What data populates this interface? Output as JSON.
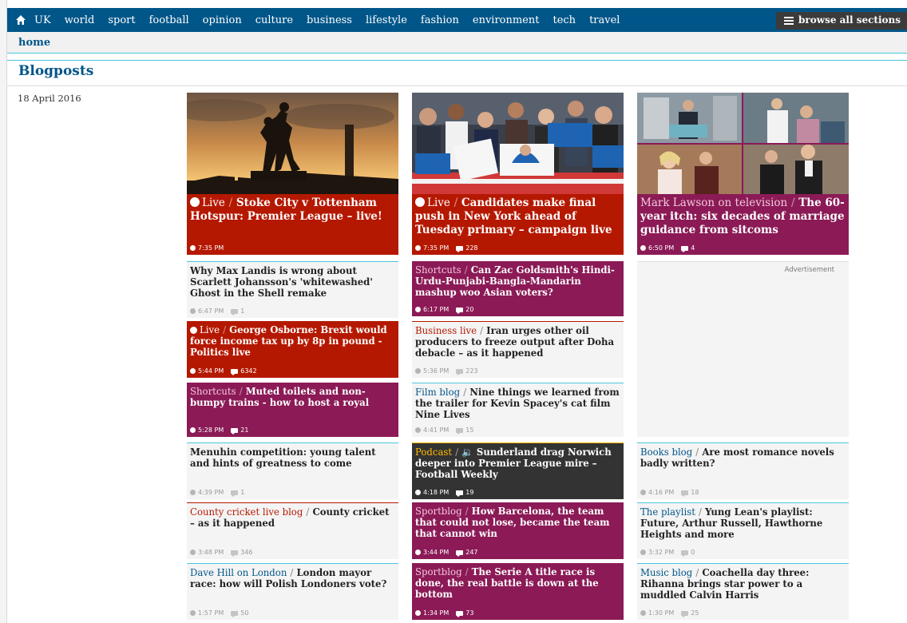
{
  "nav": {
    "items": [
      "UK",
      "world",
      "sport",
      "football",
      "opinion",
      "culture",
      "business",
      "lifestyle",
      "fashion",
      "environment",
      "tech",
      "travel"
    ],
    "browse_label": "browse all sections"
  },
  "breadcrumb": {
    "home": "home"
  },
  "page": {
    "title": "Blogposts",
    "date": "18 April 2016"
  },
  "colors": {
    "nav": "#005689",
    "live_red": "#b51800",
    "plum": "#8b1a56",
    "dark": "#333333",
    "accent": "#4bc6df",
    "podcast_kicker": "#ffbb00"
  },
  "cards": [
    {
      "live": true,
      "kicker": "Live",
      "headline": "Stoke City v Tottenham Hotspur: Premier League – live!",
      "time": "7:35 PM",
      "comments": ""
    },
    {
      "live": true,
      "kicker": "Live",
      "headline": "Candidates make final push in New York ahead of Tuesday primary – campaign live",
      "time": "7:35 PM",
      "comments": "228"
    },
    {
      "live": false,
      "kicker": "Mark Lawson on television",
      "headline": "The 60-year itch: six decades of marriage guidance from sitcoms",
      "time": "6:50 PM",
      "comments": "4"
    },
    {
      "live": false,
      "kicker": "",
      "headline": "Why Max Landis is wrong about Scarlett Johansson's 'whitewashed' Ghost in the Shell remake",
      "time": "6:47 PM",
      "comments": "1"
    },
    {
      "live": false,
      "kicker": "Shortcuts",
      "headline": "Can Zac Goldsmith's Hindi-Urdu-Punjabi-Bangla-Mandarin mashup woo Asian voters?",
      "time": "6:17 PM",
      "comments": "20"
    },
    {
      "live": true,
      "kicker": "Live",
      "headline": "George Osborne: Brexit would force income tax up by 8p in pound - Politics live",
      "time": "5:44 PM",
      "comments": "6342"
    },
    {
      "live": false,
      "kicker": "Business live",
      "headline": "Iran urges other oil producers to freeze output after Doha debacle – as it happened",
      "time": "5:36 PM",
      "comments": "223"
    },
    {
      "live": false,
      "kicker": "Shortcuts",
      "headline": "Muted toilets and non-bumpy trains - how to host a royal",
      "time": "5:28 PM",
      "comments": "21"
    },
    {
      "live": false,
      "kicker": "Film blog",
      "headline": "Nine things we learned from the trailer for Kevin Spacey's cat film Nine Lives",
      "time": "4:41 PM",
      "comments": "15"
    },
    {
      "live": false,
      "kicker": "",
      "headline": "Menuhin competition: young talent and hints of greatness to come",
      "time": "4:39 PM",
      "comments": "1"
    },
    {
      "live": false,
      "kicker": "Podcast",
      "headline": "Sunderland drag Norwich deeper into Premier League mire – Football Weekly",
      "time": "4:18 PM",
      "comments": "19"
    },
    {
      "live": false,
      "kicker": "Books blog",
      "headline": "Are most romance novels badly written?",
      "time": "4:16 PM",
      "comments": "18"
    },
    {
      "live": false,
      "kicker": "County cricket live blog",
      "headline": "County cricket – as it happened",
      "time": "3:48 PM",
      "comments": "346"
    },
    {
      "live": false,
      "kicker": "Sportblog",
      "headline": "How Barcelona, the team that could not lose, became the team that cannot win",
      "time": "3:44 PM",
      "comments": "247"
    },
    {
      "live": false,
      "kicker": "The playlist",
      "headline": "Yung Lean's playlist: Future, Arthur Russell, Hawthorne Heights and more",
      "time": "3:32 PM",
      "comments": "0"
    },
    {
      "live": false,
      "kicker": "Dave Hill on London",
      "headline": "London mayor race: how will Polish Londoners vote?",
      "time": "1:57 PM",
      "comments": "50"
    },
    {
      "live": false,
      "kicker": "Sportblog",
      "headline": "The Serie A title race is done, the real battle is down at the bottom",
      "time": "1:34 PM",
      "comments": "73"
    },
    {
      "live": false,
      "kicker": "Music blog",
      "headline": "Coachella day three: Rihanna brings star power to a muddled Calvin Harris",
      "time": "1:30 PM",
      "comments": "25"
    }
  ],
  "ad": {
    "label": "Advertisement"
  }
}
